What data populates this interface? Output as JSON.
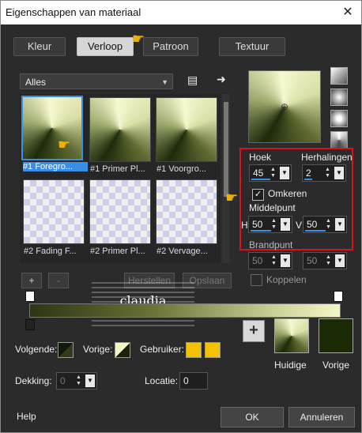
{
  "window": {
    "title": "Eigenschappen van materiaal",
    "close_glyph": "✕"
  },
  "tabs": [
    {
      "label": "Kleur"
    },
    {
      "label": "Verloop"
    },
    {
      "label": "Patroon"
    },
    {
      "label": "Textuur"
    }
  ],
  "category_dropdown": {
    "value": "Alles",
    "arrow": "▼"
  },
  "gallery": [
    {
      "label": "#1 Foregro...",
      "selected": true,
      "style": "sunburst"
    },
    {
      "label": "#1 Primer Pl...",
      "selected": false,
      "style": "sunburst"
    },
    {
      "label": "#1 Voorgro...",
      "selected": false,
      "style": "sunburst"
    },
    {
      "label": "#2 Fading F...",
      "selected": false,
      "style": "checker"
    },
    {
      "label": "#2 Primer Pl...",
      "selected": false,
      "style": "checker"
    },
    {
      "label": "#2 Vervage...",
      "selected": false,
      "style": "checker"
    }
  ],
  "settings": {
    "hoek_label": "Hoek",
    "hoek_value": "45",
    "herhalingen_label": "Herhalingen",
    "herhalingen_value": "2",
    "omkeren_label": "Omkeren",
    "omkeren_checked": true,
    "middelpunt_label": "Middelpunt",
    "h_label": "H",
    "h_value": "50",
    "v_label": "V",
    "v_value": "50",
    "brandpunt_label": "Brandpunt",
    "bh_value": "50",
    "bv_value": "50",
    "koppelen_label": "Koppelen"
  },
  "gradient_buttons": {
    "add": "+",
    "remove": "-",
    "herstellen": "Herstellen",
    "opslaan": "Opslaan"
  },
  "watermark": {
    "text": "claudia"
  },
  "colors": {
    "volgende_label": "Volgende:",
    "vorige_label": "Vorige:",
    "gebruiker_label": "Gebruiker:",
    "custom_color_1": "#f2c200",
    "custom_color_2": "#f2c200",
    "current_label": "Huidige",
    "previous_label": "Vorige",
    "plus": "+"
  },
  "opacity": {
    "dekking_label": "Dekking:",
    "dekking_value": "0",
    "locatie_label": "Locatie:",
    "locatie_value": "0"
  },
  "footer": {
    "help": "Help",
    "ok": "OK",
    "cancel": "Annuleren"
  }
}
